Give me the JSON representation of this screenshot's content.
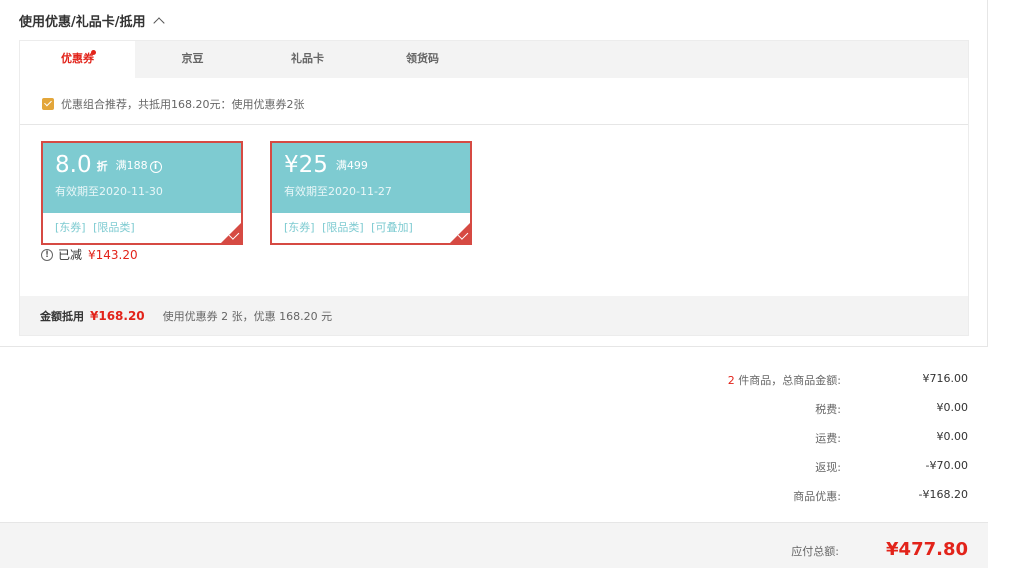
{
  "section": {
    "title": "使用优惠/礼品卡/抵用"
  },
  "tabs": [
    {
      "label": "优惠券"
    },
    {
      "label": "京豆"
    },
    {
      "label": "礼品卡"
    },
    {
      "label": "领货码"
    }
  ],
  "recommend": {
    "text": "优惠组合推荐，共抵用168.20元：使用优惠券2张"
  },
  "coupons": [
    {
      "amount": "8.0",
      "unit": "折",
      "condition": "满188",
      "expiry": "有效期至2020-11-30",
      "tags": "[东券] [限品类]"
    },
    {
      "amount": "¥25",
      "unit": "",
      "condition": "满499",
      "expiry": "有效期至2020-11-27",
      "tags": "[东券] [限品类] [可叠加]"
    }
  ],
  "reduced": {
    "label": "已减",
    "value": "¥143.20"
  },
  "footer": {
    "label": "金额抵用",
    "amount": "¥168.20",
    "desc": "使用优惠券 2 张，优惠 168.20 元"
  },
  "summary": {
    "count": "2",
    "items_label": " 件商品，总商品金额:",
    "items_value": "¥716.00",
    "tax_label": "税费:",
    "tax_value": "¥0.00",
    "shipping_label": "运费:",
    "shipping_value": "¥0.00",
    "cashback_label": "返现:",
    "cashback_value": "-¥70.00",
    "discount_label": "商品优惠:",
    "discount_value": "-¥168.20"
  },
  "total": {
    "label": "应付总额:",
    "value": "¥477.80"
  },
  "colors": {
    "accent_red": "#e2231a",
    "coupon_teal": "#7ecbd1",
    "coupon_border": "#d64a43",
    "checkbox": "#e3a63a"
  }
}
